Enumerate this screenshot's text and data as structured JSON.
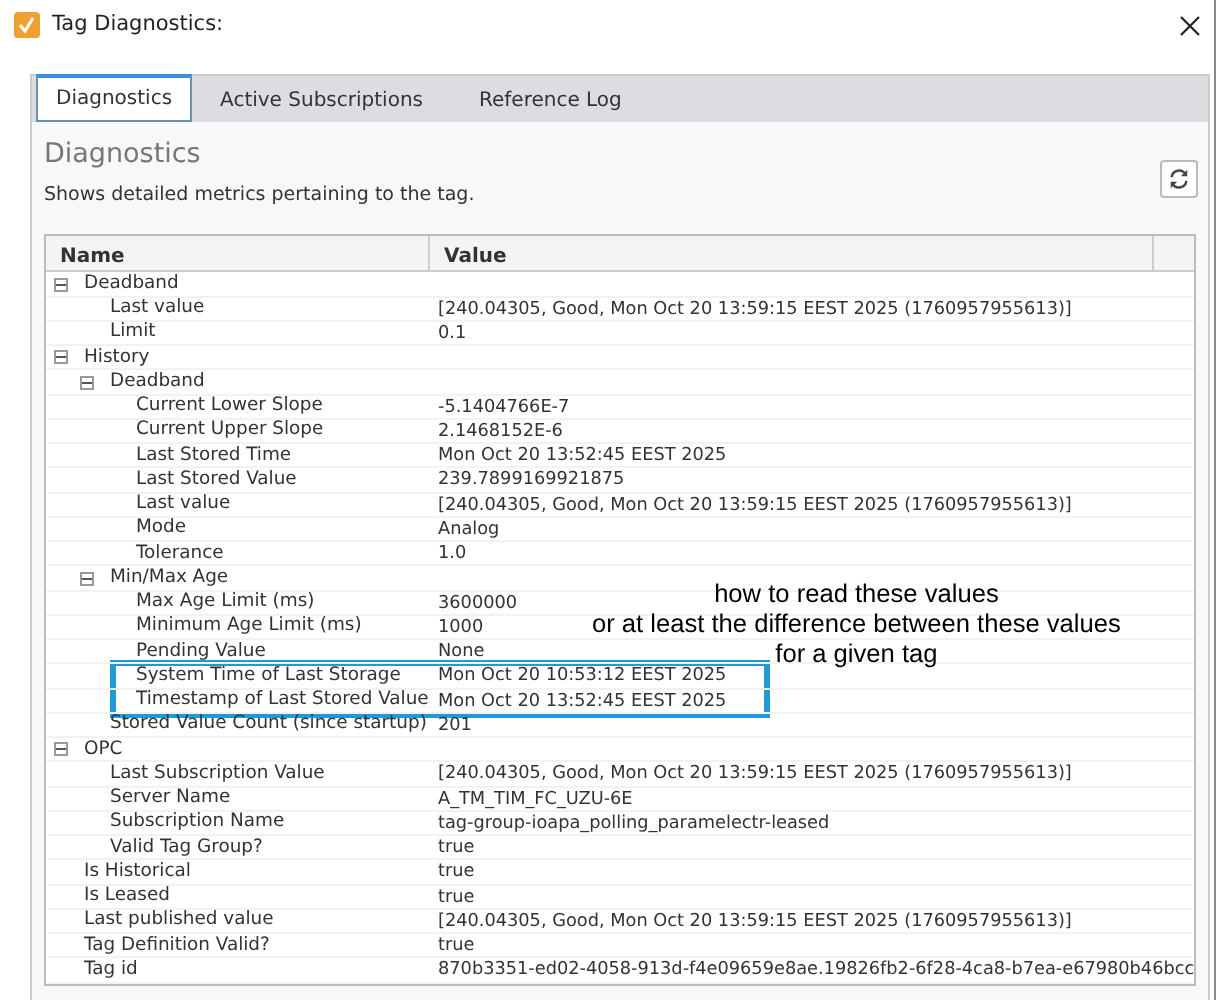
{
  "window": {
    "title": "Tag Diagnostics:"
  },
  "tabs": [
    {
      "label": "Diagnostics",
      "selected": true
    },
    {
      "label": "Active Subscriptions",
      "selected": false
    },
    {
      "label": "Reference Log",
      "selected": false
    }
  ],
  "panel": {
    "heading": "Diagnostics",
    "description": "Shows detailed metrics pertaining to the tag."
  },
  "table": {
    "columns": [
      "Name",
      "Value"
    ],
    "rows": [
      {
        "name": "Deadband",
        "expanded": true,
        "children": [
          {
            "name": "Last value",
            "value": "[240.04305, Good, Mon Oct 20 13:59:15 EEST 2025 (1760957955613)]"
          },
          {
            "name": "Limit",
            "value": "0.1"
          }
        ]
      },
      {
        "name": "History",
        "expanded": true,
        "children": [
          {
            "name": "Deadband",
            "expanded": true,
            "children": [
              {
                "name": "Current Lower Slope",
                "value": "-5.1404766E-7"
              },
              {
                "name": "Current Upper Slope",
                "value": "2.1468152E-6"
              },
              {
                "name": "Last Stored Time",
                "value": "Mon Oct 20 13:52:45 EEST 2025"
              },
              {
                "name": "Last Stored Value",
                "value": "239.7899169921875"
              },
              {
                "name": "Last value",
                "value": "[240.04305, Good, Mon Oct 20 13:59:15 EEST 2025 (1760957955613)]"
              },
              {
                "name": "Mode",
                "value": "Analog"
              },
              {
                "name": "Tolerance",
                "value": "1.0"
              }
            ]
          },
          {
            "name": "Min/Max Age",
            "expanded": true,
            "children": [
              {
                "name": "Max Age Limit (ms)",
                "value": "3600000"
              },
              {
                "name": "Minimum Age Limit (ms)",
                "value": "1000"
              },
              {
                "name": "Pending Value",
                "value": "None"
              },
              {
                "name": "System Time of Last Storage",
                "value": "Mon Oct 20 10:53:12 EEST 2025",
                "highlighted": true
              },
              {
                "name": "Timestamp of Last Stored Value",
                "value": "Mon Oct 20 13:52:45 EEST 2025",
                "highlighted": true
              }
            ]
          },
          {
            "name": "Stored Value Count (since startup)",
            "value": "201"
          }
        ]
      },
      {
        "name": "OPC",
        "expanded": true,
        "children": [
          {
            "name": "Last Subscription Value",
            "value": "[240.04305, Good, Mon Oct 20 13:59:15 EEST 2025 (1760957955613)]"
          },
          {
            "name": "Server Name",
            "value": "A_TM_TIM_FC_UZU-6E"
          },
          {
            "name": "Subscription Name",
            "value": "tag-group-ioapa_polling_paramelectr-leased"
          },
          {
            "name": "Valid Tag Group?",
            "value": "true"
          }
        ]
      },
      {
        "name": "Is Historical",
        "value": "true"
      },
      {
        "name": "Is Leased",
        "value": "true"
      },
      {
        "name": "Last published value",
        "value": "[240.04305, Good, Mon Oct 20 13:59:15 EEST 2025 (1760957955613)]"
      },
      {
        "name": "Tag Definition Valid?",
        "value": "true"
      },
      {
        "name": "Tag id",
        "value": "870b3351-ed02-4058-913d-f4e09659e8ae.19826fb2-6f28-4ca8-b7ea-e67980b46bcc"
      }
    ]
  },
  "annotation": {
    "lines": [
      "how to read these values",
      "or at least the difference between these values",
      "for a given tag"
    ]
  }
}
